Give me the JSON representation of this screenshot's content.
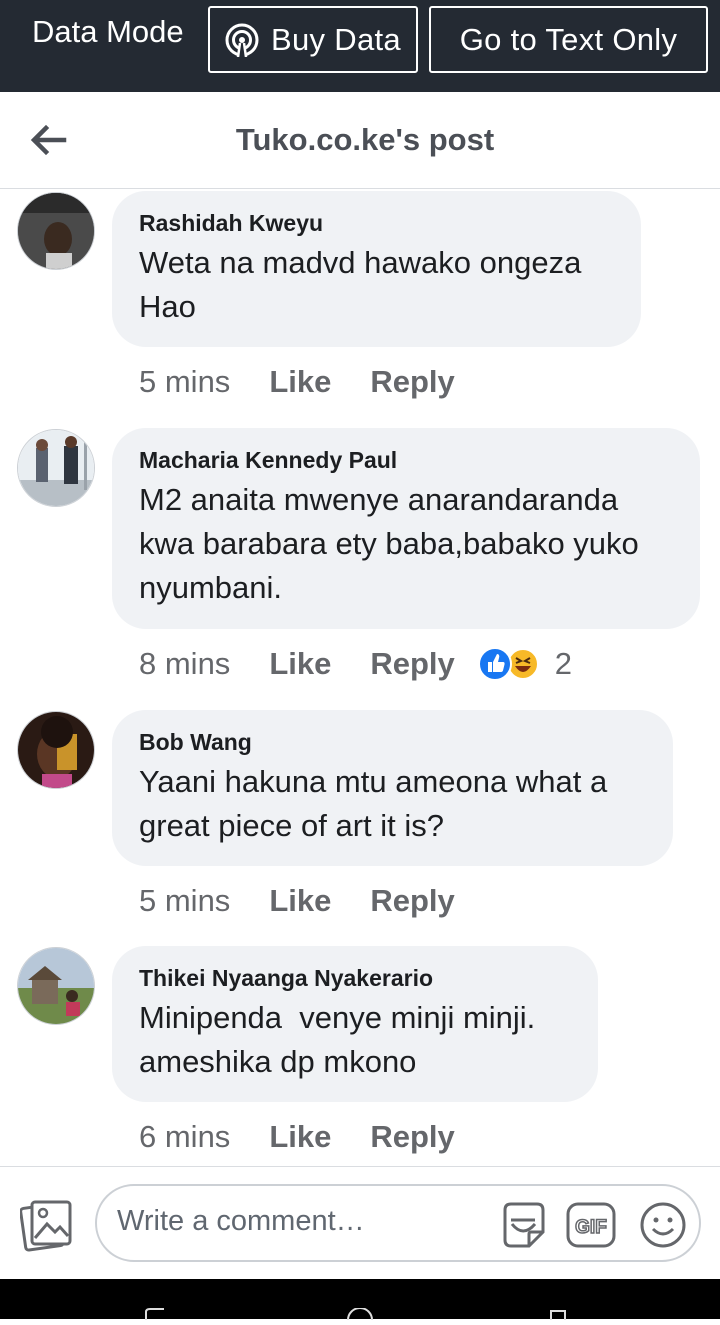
{
  "data_bar": {
    "label": "Data Mode",
    "buy_data": "Buy Data",
    "text_only": "Go to Text Only"
  },
  "header": {
    "title": "Tuko.co.ke's post"
  },
  "comments": [
    {
      "author": "Rashidah Kweyu",
      "text": "Weta na madvd hawako ongeza\nHao",
      "time": "5 mins",
      "like": "Like",
      "reply": "Reply"
    },
    {
      "author": "Macharia Kennedy Paul",
      "text": "M2 anaita mwenye anarandaranda\nkwa barabara ety baba,babako yuko\nnyumbani.",
      "time": "8 mins",
      "like": "Like",
      "reply": "Reply",
      "reaction_count": "2",
      "reactions": [
        "like-reaction-icon",
        "haha-reaction-icon"
      ]
    },
    {
      "author": "Bob Wang",
      "text": "Yaani hakuna mtu ameona what a\ngreat piece of art it is?",
      "time": "5 mins",
      "like": "Like",
      "reply": "Reply"
    },
    {
      "author": "Thikei Nyaanga Nyakerario",
      "text": "Minipenda  venye minji minji.\nameshika dp mkono",
      "time": "6 mins",
      "like": "Like",
      "reply": "Reply"
    }
  ],
  "composer": {
    "placeholder": "Write a comment…"
  },
  "colors": {
    "data_bar_bg": "#242a33",
    "bubble_bg": "#f0f2f5",
    "like_blue": "#1877f2",
    "haha_yellow": "#f7b928"
  }
}
